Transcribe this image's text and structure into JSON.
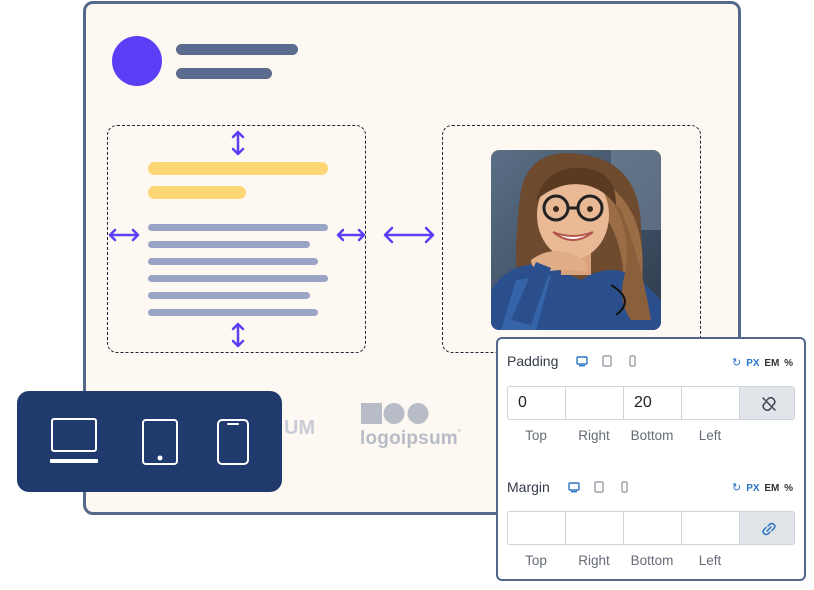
{
  "colors": {
    "window_border": "#56698b",
    "window_bg": "#fdf8f1",
    "avatar": "#5b3ff6",
    "accent_yellow": "#fdd676",
    "text_line": "#9aa4c5",
    "arrow": "#5b3ff6",
    "device_bar": "#213a6e",
    "link_blue": "#2a74c6"
  },
  "logos": {
    "faded_fragment": "UM",
    "logo_text": "logoipsum",
    "logo_mark_icon": "logo-shapes-icon"
  },
  "device_switcher": {
    "items": [
      {
        "name": "desktop-icon",
        "active": true
      },
      {
        "name": "tablet-icon",
        "active": false
      },
      {
        "name": "mobile-icon",
        "active": false
      }
    ]
  },
  "panel": {
    "padding": {
      "label": "Padding",
      "reset_icon": "reset-icon",
      "units": {
        "px": "PX",
        "em": "EM",
        "pct": "%"
      },
      "values": {
        "top": "0",
        "right": "",
        "bottom": "20",
        "left": ""
      },
      "link_icon": "unlink-icon"
    },
    "margin": {
      "label": "Margin",
      "reset_icon": "reset-icon",
      "units": {
        "px": "PX",
        "em": "EM",
        "pct": "%"
      },
      "values": {
        "top": "",
        "right": "",
        "bottom": "",
        "left": ""
      },
      "link_icon": "link-icon"
    },
    "side_labels": {
      "top": "Top",
      "right": "Right",
      "bottom": "Bottom",
      "left": "Left"
    }
  }
}
